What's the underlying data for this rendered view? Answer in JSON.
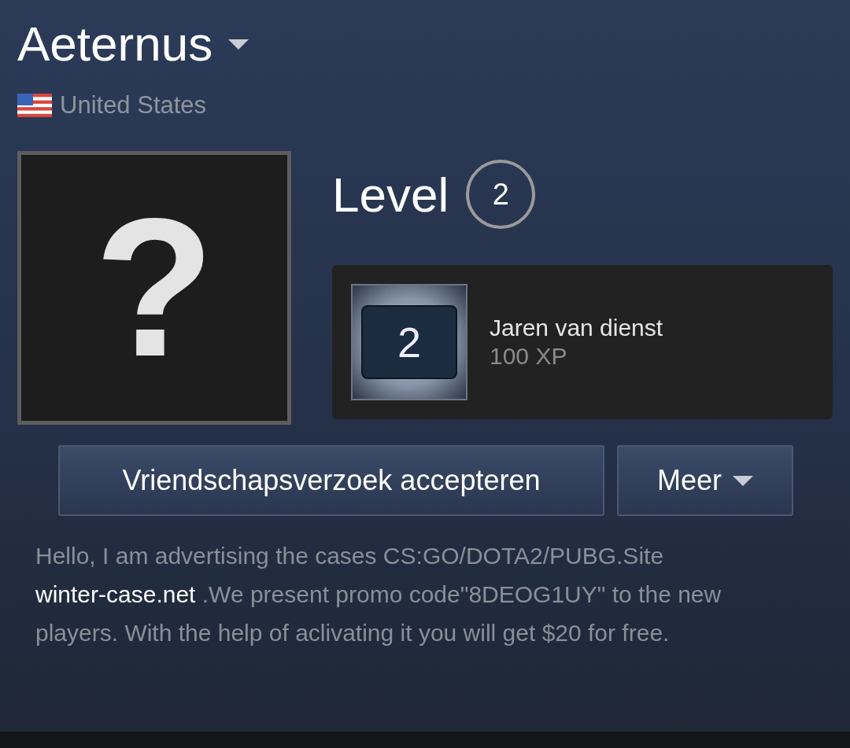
{
  "profile": {
    "name": "Aeternus",
    "country": "United States",
    "avatar_glyph": "?"
  },
  "level": {
    "label": "Level",
    "value": "2"
  },
  "badge": {
    "number": "2",
    "title": "Jaren van dienst",
    "xp": "100 XP"
  },
  "buttons": [
    {
      "label": "Vriendschapsverzoek accepteren",
      "kind": "plain"
    },
    {
      "label": "Meer",
      "kind": "dropdown"
    }
  ],
  "summary": {
    "before": "Hello, I am advertising the cases CS:GO/DOTA2/PUBG.Site",
    "link": "winter-case.net",
    "after": ".We present promo code\"8DEOG1UY\" to the new players. With the help of aclivating it you will get $20 for free."
  }
}
